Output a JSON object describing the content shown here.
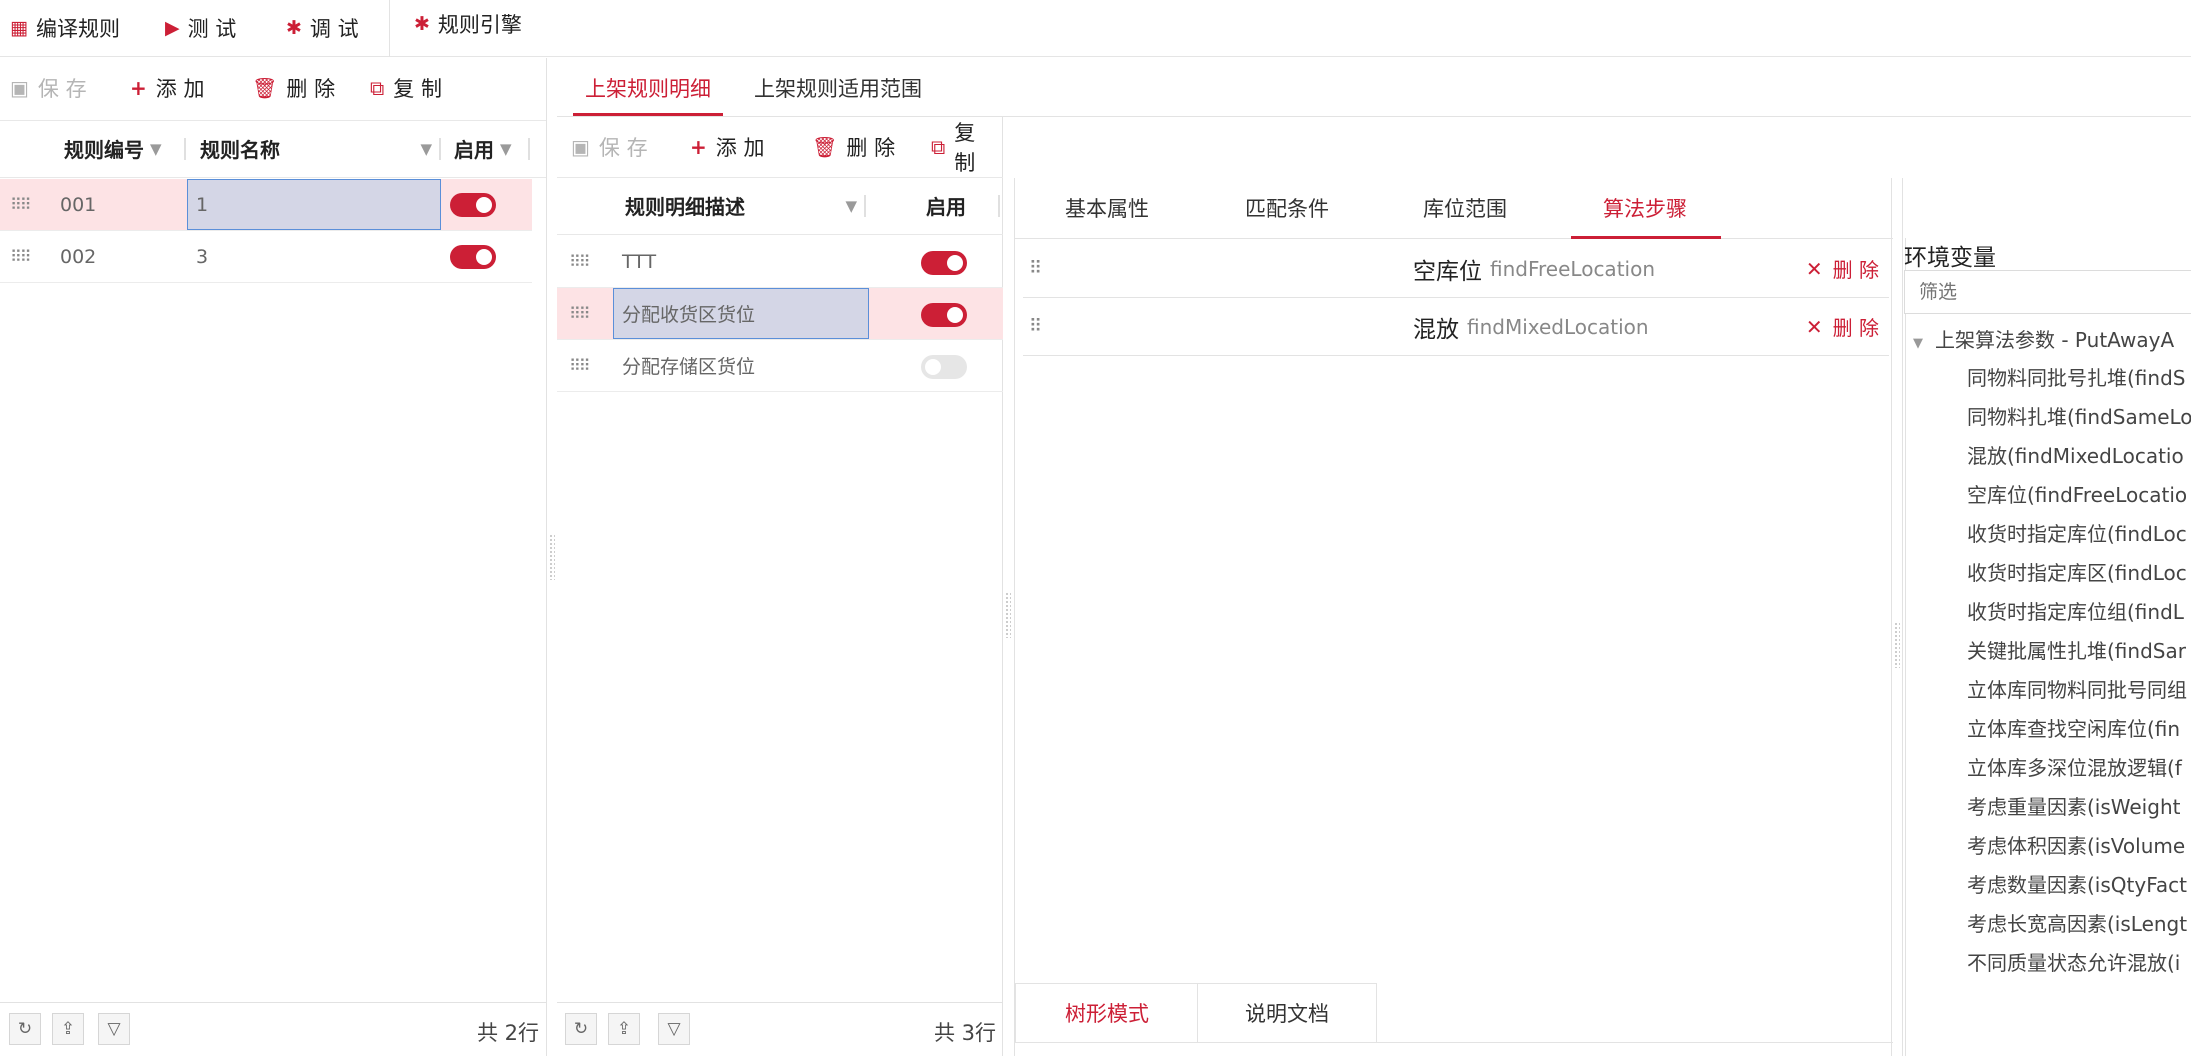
{
  "toolbar": {
    "compile": "编译规则",
    "test": "测 试",
    "debug": "调 试",
    "engine": "规则引擎"
  },
  "left_actions": {
    "save": "保 存",
    "add": "添 加",
    "delete": "删 除",
    "copy": "复 制"
  },
  "rules_grid": {
    "columns": {
      "code": "规则编号",
      "name": "规则名称",
      "enabled": "启用"
    },
    "rows": [
      {
        "code": "001",
        "name": "1",
        "enabled": true
      },
      {
        "code": "002",
        "name": "3",
        "enabled": true
      }
    ],
    "count": "共 2行"
  },
  "middle_tabs": {
    "detail": "上架规则明细",
    "scope": "上架规则适用范围"
  },
  "middle_actions": {
    "save": "保 存",
    "add": "添 加",
    "delete": "删 除",
    "copy": "复 制"
  },
  "detail_grid": {
    "columns": {
      "desc": "规则明细描述",
      "enabled": "启用"
    },
    "rows": [
      {
        "desc": "TTT",
        "enabled": true
      },
      {
        "desc": "分配收货区货位",
        "enabled": true
      },
      {
        "desc": "分配存储区货位",
        "enabled": false
      }
    ],
    "count": "共 3行"
  },
  "right_tabs": {
    "basic": "基本属性",
    "match": "匹配条件",
    "location": "库位范围",
    "algo": "算法步骤"
  },
  "steps": [
    {
      "name": "空库位",
      "code": "findFreeLocation",
      "delete": "删 除"
    },
    {
      "name": "混放",
      "code": "findMixedLocation",
      "delete": "删 除"
    }
  ],
  "bottom_tabs": {
    "tree": "树形模式",
    "doc": "说明文档"
  },
  "env": {
    "title": "环境变量",
    "filter_placeholder": "筛选",
    "root": "上架算法参数 - PutAwayA",
    "items": [
      "同物料同批号扎堆(findS",
      "同物料扎堆(findSameLo",
      "混放(findMixedLocatio",
      "空库位(findFreeLocatio",
      "收货时指定库位(findLoc",
      "收货时指定库区(findLoc",
      "收货时指定库位组(findL",
      "关键批属性扎堆(findSar",
      "立体库同物料同批号同组",
      "立体库查找空闲库位(fin",
      "立体库多深位混放逻辑(f",
      "考虑重量因素(isWeight",
      "考虑体积因素(isVolume",
      "考虑数量因素(isQtyFact",
      "考虑长宽高因素(isLengt",
      "不同质量状态允许混放(i"
    ]
  }
}
